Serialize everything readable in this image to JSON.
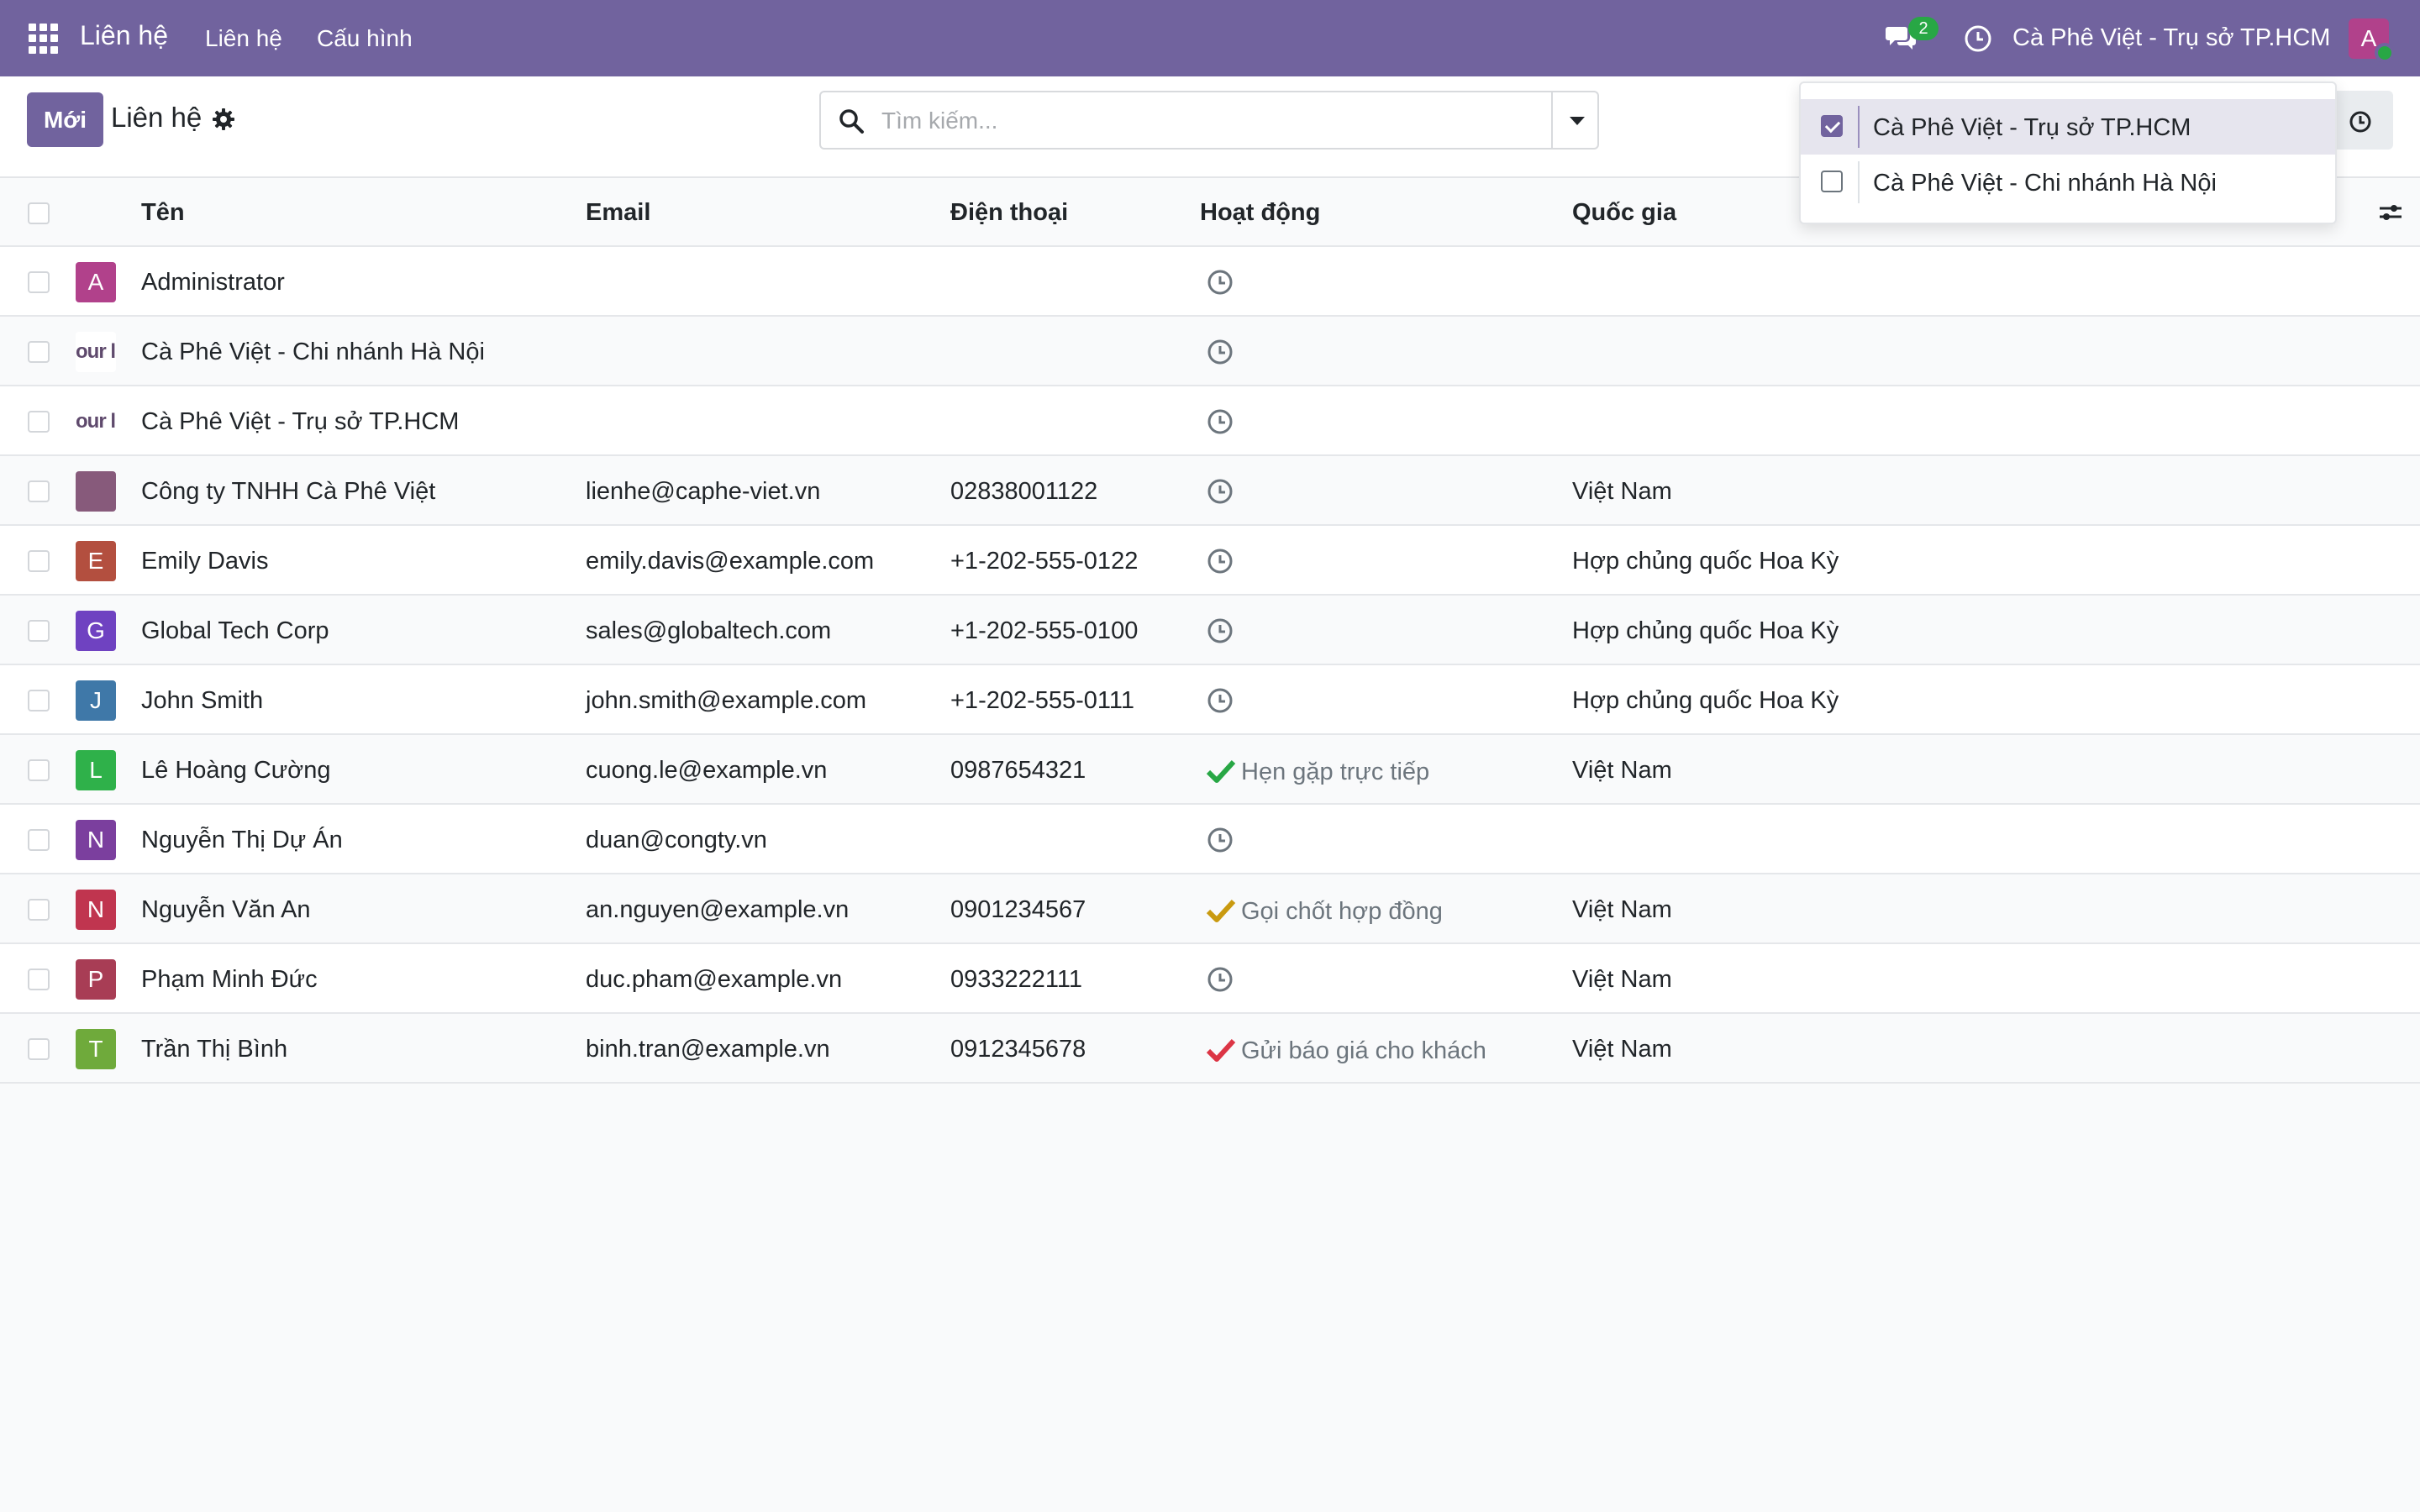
{
  "navbar": {
    "app_name": "Liên hệ",
    "menus": [
      "Liên hệ",
      "Cấu hình"
    ],
    "chat_badge": "2",
    "current_company": "Cà Phê Việt - Trụ sở TP.HCM",
    "user_initial": "A"
  },
  "control_panel": {
    "new_button": "Mới",
    "title": "Liên hệ",
    "search_placeholder": "Tìm kiếm..."
  },
  "table": {
    "columns": [
      "Tên",
      "Email",
      "Điện thoại",
      "Hoạt động",
      "Quốc gia"
    ],
    "rows": [
      {
        "avatar": "A",
        "avatar_color": "#b1418b",
        "name": "Administrator",
        "email": "",
        "phone": "",
        "activity": "clock",
        "activity_text": "",
        "country": ""
      },
      {
        "avatar": "our l",
        "avatar_color": "logo",
        "name": "Cà Phê Việt - Chi nhánh Hà Nội",
        "email": "",
        "phone": "",
        "activity": "clock",
        "activity_text": "",
        "country": ""
      },
      {
        "avatar": "our l",
        "avatar_color": "logo",
        "name": "Cà Phê Việt - Trụ sở TP.HCM",
        "email": "",
        "phone": "",
        "activity": "clock",
        "activity_text": "",
        "country": ""
      },
      {
        "avatar": "",
        "avatar_color": "#875a7b",
        "name": "Công ty TNHH Cà Phê Việt",
        "email": "lienhe@caphe-viet.vn",
        "phone": "02838001122",
        "activity": "clock",
        "activity_text": "",
        "country": "Việt Nam"
      },
      {
        "avatar": "E",
        "avatar_color": "#b34f3f",
        "name": "Emily Davis",
        "email": "emily.davis@example.com",
        "phone": "+1-202-555-0122",
        "activity": "clock",
        "activity_text": "",
        "country": "Hợp chủng quốc Hoa Kỳ"
      },
      {
        "avatar": "G",
        "avatar_color": "#6f42c1",
        "name": "Global Tech Corp",
        "email": "sales@globaltech.com",
        "phone": "+1-202-555-0100",
        "activity": "clock",
        "activity_text": "",
        "country": "Hợp chủng quốc Hoa Kỳ"
      },
      {
        "avatar": "J",
        "avatar_color": "#3f78a8",
        "name": "John Smith",
        "email": "john.smith@example.com",
        "phone": "+1-202-555-0111",
        "activity": "clock",
        "activity_text": "",
        "country": "Hợp chủng quốc Hoa Kỳ"
      },
      {
        "avatar": "L",
        "avatar_color": "#2fb14a",
        "name": "Lê Hoàng Cường",
        "email": "cuong.le@example.vn",
        "phone": "0987654321",
        "activity": "check",
        "activity_color": "#28a745",
        "activity_text": "Hẹn gặp trực tiếp",
        "country": "Việt Nam"
      },
      {
        "avatar": "N",
        "avatar_color": "#7b3f9e",
        "name": "Nguyễn Thị Dự Án",
        "email": "duan@congty.vn",
        "phone": "",
        "activity": "clock",
        "activity_text": "",
        "country": ""
      },
      {
        "avatar": "N",
        "avatar_color": "#c0354f",
        "name": "Nguyễn Văn An",
        "email": "an.nguyen@example.vn",
        "phone": "0901234567",
        "activity": "check",
        "activity_color": "#c99a10",
        "activity_text": "Gọi chốt hợp đồng",
        "country": "Việt Nam"
      },
      {
        "avatar": "P",
        "avatar_color": "#a83d55",
        "name": "Phạm Minh Đức",
        "email": "duc.pham@example.vn",
        "phone": "0933222111",
        "activity": "clock",
        "activity_text": "",
        "country": "Việt Nam"
      },
      {
        "avatar": "T",
        "avatar_color": "#6faa3b",
        "name": "Trần Thị Bình",
        "email": "binh.tran@example.vn",
        "phone": "0912345678",
        "activity": "check",
        "activity_color": "#dc3545",
        "activity_text": "Gửi báo giá cho khách",
        "country": "Việt Nam"
      }
    ]
  },
  "company_dropdown": {
    "items": [
      {
        "label": "Cà Phê Việt - Trụ sở TP.HCM",
        "checked": true
      },
      {
        "label": "Cà Phê Việt - Chi nhánh Hà Nội",
        "checked": false
      }
    ]
  },
  "colors": {
    "brand": "#71639e",
    "success": "#28a745"
  }
}
